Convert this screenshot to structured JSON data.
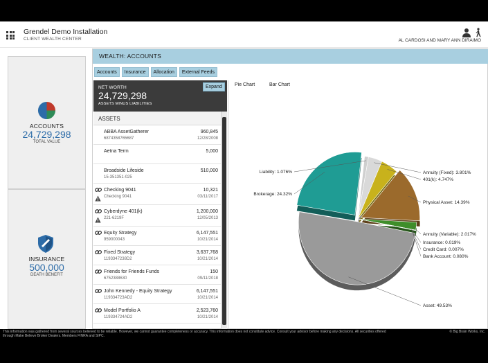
{
  "header": {
    "app_title": "Grendel Demo Installation",
    "app_subtitle": "CLIENT WEALTH CENTER",
    "user_names": "AL CARDOSI AND MARY ANN DIRAIMO"
  },
  "cards": {
    "accounts": {
      "label": "ACCOUNTS",
      "value": "24,729,298",
      "sub": "TOTAL VALUE"
    },
    "insurance": {
      "label": "INSURANCE",
      "value": "500,000",
      "sub": "DEATH BENEFIT"
    }
  },
  "main": {
    "title": "WEALTH: ACCOUNTS",
    "tabs": [
      "Accounts",
      "Insurance",
      "Allocation",
      "External Feeds"
    ]
  },
  "net_worth": {
    "label": "NET WORTH",
    "value": "24,729,298",
    "sub": "ASSETS MINUS LIABILITIES",
    "expand_label": "Expand"
  },
  "assets": {
    "header": "ASSETS",
    "rows": [
      {
        "name": "ABBA AssetGatherer",
        "number": "6874358765687",
        "value": "960,845",
        "date": "12/28/2008",
        "linked": false,
        "warning": false
      },
      {
        "name": "Aetna Term",
        "number": "",
        "value": "5,000",
        "date": "",
        "linked": false,
        "warning": false
      },
      {
        "name": "Broadside Lifeside",
        "number": "15-351351-025",
        "value": "510,000",
        "date": "",
        "linked": false,
        "warning": false
      },
      {
        "name": "Checking 9041",
        "number": "Checking 9041",
        "value": "10,321",
        "date": "03/11/2017",
        "linked": true,
        "warning": true
      },
      {
        "name": "Cyberdyne 401(k)",
        "number": "221-6219F",
        "value": "1,200,000",
        "date": "12/05/2013",
        "linked": true,
        "warning": true
      },
      {
        "name": "Equity Strategy",
        "number": "959000043",
        "value": "6,147,551",
        "date": "10/21/2014",
        "linked": true,
        "warning": false
      },
      {
        "name": "Fixed Strategy",
        "number": "1193347238D2",
        "value": "3,637,768",
        "date": "10/21/2014",
        "linked": true,
        "warning": false
      },
      {
        "name": "Friends for Friends Funds",
        "number": "6752388630",
        "value": "150",
        "date": "09/11/2018",
        "linked": true,
        "warning": false
      },
      {
        "name": "John Kennedy - Equity Strategy",
        "number": "119334723AD2",
        "value": "6,147,551",
        "date": "10/21/2014",
        "linked": true,
        "warning": false
      },
      {
        "name": "Model Portfolio A",
        "number": "119334724AD2",
        "value": "2,523,760",
        "date": "10/21/2014",
        "linked": true,
        "warning": false
      }
    ]
  },
  "chart_tabs": [
    "Pie Chart",
    "Bar Chart"
  ],
  "chart_data": {
    "type": "pie",
    "title": "",
    "slices": [
      {
        "label": "Asset",
        "value": 49.53,
        "text": "Asset: 49.53%",
        "color": "#9a9a9a"
      },
      {
        "label": "Brokerage",
        "value": 24.32,
        "text": "Brokerage: 24.32%",
        "color": "#1f9c94"
      },
      {
        "label": "Liability",
        "value": 1.076,
        "text": "Liability: 1.076%",
        "color": "#cfcfcf"
      },
      {
        "label": "Annuity (Fixed)",
        "value": 3.801,
        "text": "Annuity (Fixed): 3.801%",
        "color": "#d9d9d9"
      },
      {
        "label": "401(k)",
        "value": 4.747,
        "text": "401(k): 4.747%",
        "color": "#c8b21c"
      },
      {
        "label": "Physical Asset",
        "value": 14.39,
        "text": "Physical Asset: 14.39%",
        "color": "#9b6a2c"
      },
      {
        "label": "Annuity (Variable)",
        "value": 2.017,
        "text": "Annuity (Variable): 2.017%",
        "color": "#3e8e2a"
      },
      {
        "label": "Insurance",
        "value": 0.019,
        "text": "Insurance: 0.019%",
        "color": "#6a8fb0"
      },
      {
        "label": "Credit Card",
        "value": 0.007,
        "text": "Credit Card: 0.007%",
        "color": "#b04040"
      },
      {
        "label": "Bank Account",
        "value": 0.08,
        "text": "Bank Account: 0.080%",
        "color": "#5aa05a"
      }
    ]
  },
  "footer": {
    "disclaimer_1": "This information was gathered from several sources believed to be reliable. However, we cannot guarantee completeness or accuracy. This information does not constitute advice. Consult your advisor before making any decisions. All securities offered",
    "disclaimer_2": "through Make Believe Broker Dealers. Members FINRA and SIPC.",
    "copyright": "© Big Brain Works, Inc."
  }
}
